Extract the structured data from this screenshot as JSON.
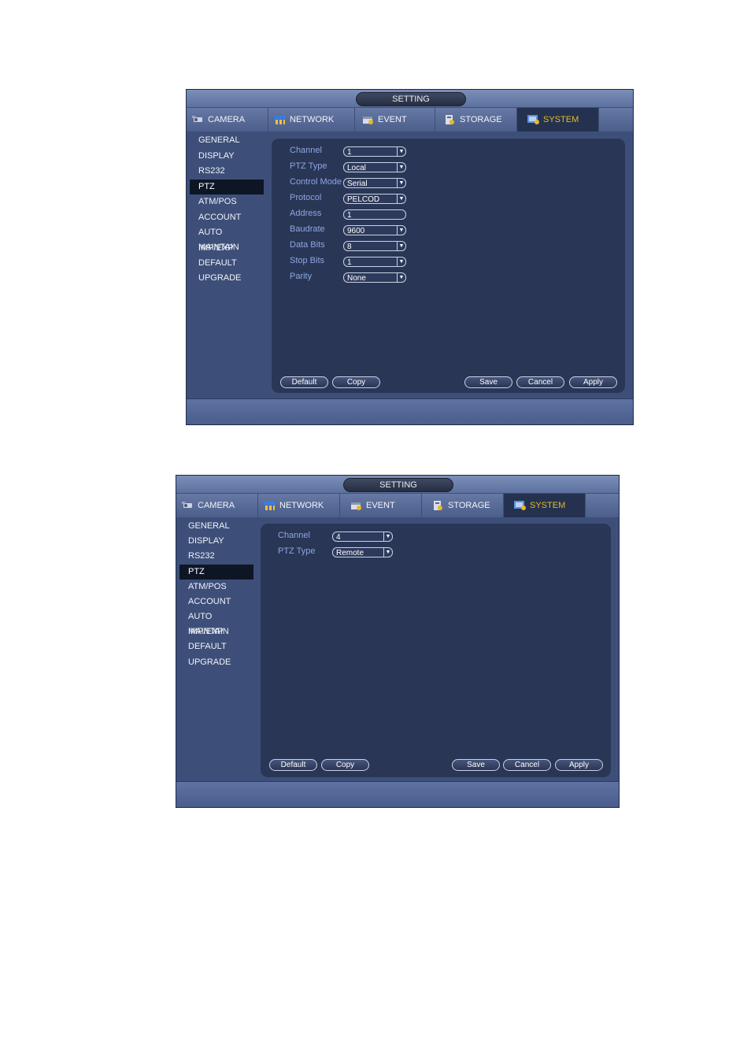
{
  "windows": [
    {
      "title": "SETTING",
      "tabs": [
        {
          "label": "CAMERA",
          "icon": "camera-icon"
        },
        {
          "label": "NETWORK",
          "icon": "network-icon"
        },
        {
          "label": "EVENT",
          "icon": "event-icon"
        },
        {
          "label": "STORAGE",
          "icon": "storage-icon"
        },
        {
          "label": "SYSTEM",
          "icon": "system-icon",
          "active": true
        }
      ],
      "sidebar": [
        "GENERAL",
        "DISPLAY",
        "RS232",
        "PTZ",
        "ATM/POS",
        "ACCOUNT",
        "AUTO MAINTAIN",
        "IMP/EXP",
        "DEFAULT",
        "UPGRADE"
      ],
      "sidebar_active": "PTZ",
      "fields": [
        {
          "label": "Channel",
          "value": "1",
          "dropdown": true
        },
        {
          "label": "PTZ Type",
          "value": "Local",
          "dropdown": true
        },
        {
          "label": "Control Mode",
          "value": "Serial",
          "dropdown": true
        },
        {
          "label": "Protocol",
          "value": "PELCOD",
          "dropdown": true
        },
        {
          "label": "Address",
          "value": "1",
          "dropdown": false
        },
        {
          "label": "Baudrate",
          "value": "9600",
          "dropdown": true
        },
        {
          "label": "Data Bits",
          "value": "8",
          "dropdown": true
        },
        {
          "label": "Stop Bits",
          "value": "1",
          "dropdown": true
        },
        {
          "label": "Parity",
          "value": "None",
          "dropdown": true
        }
      ],
      "buttons": {
        "default": "Default",
        "copy": "Copy",
        "save": "Save",
        "cancel": "Cancel",
        "apply": "Apply"
      }
    },
    {
      "title": "SETTING",
      "tabs": [
        {
          "label": "CAMERA",
          "icon": "camera-icon"
        },
        {
          "label": "NETWORK",
          "icon": "network-icon"
        },
        {
          "label": "EVENT",
          "icon": "event-icon"
        },
        {
          "label": "STORAGE",
          "icon": "storage-icon"
        },
        {
          "label": "SYSTEM",
          "icon": "system-icon",
          "active": true
        }
      ],
      "sidebar": [
        "GENERAL",
        "DISPLAY",
        "RS232",
        "PTZ",
        "ATM/POS",
        "ACCOUNT",
        "AUTO MAINTAIN",
        "IMP/EXP",
        "DEFAULT",
        "UPGRADE"
      ],
      "sidebar_active": "PTZ",
      "fields": [
        {
          "label": "Channel",
          "value": "4",
          "dropdown": true
        },
        {
          "label": "PTZ Type",
          "value": "Remote",
          "dropdown": true
        }
      ],
      "buttons": {
        "default": "Default",
        "copy": "Copy",
        "save": "Save",
        "cancel": "Cancel",
        "apply": "Apply"
      }
    }
  ],
  "colors": {
    "window_bg": "#3d4f79",
    "panel_bg": "#2a3656",
    "label_text": "#8ca7e0",
    "active_tab_text": "#e8b923",
    "active_sidebar_bg": "#0e1626"
  }
}
